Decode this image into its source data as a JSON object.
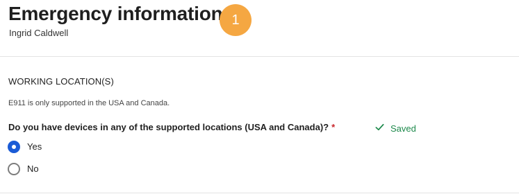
{
  "header": {
    "title": "Emergency information",
    "subtitle": "Ingrid Caldwell",
    "step_badge": "1",
    "badge_color": "#f5a742"
  },
  "section": {
    "heading": "WORKING LOCATION(S)",
    "note": "E911 is only supported in the USA and Canada."
  },
  "question": {
    "label": "Do you have devices in any of the supported locations (USA and Canada)?",
    "required_marker": "*",
    "status_icon": "checkmark-icon",
    "status_text": "Saved",
    "status_color": "#1e8a4c",
    "options": [
      {
        "label": "Yes",
        "selected": true
      },
      {
        "label": "No",
        "selected": false
      }
    ],
    "accent_color": "#1a5bd6"
  }
}
